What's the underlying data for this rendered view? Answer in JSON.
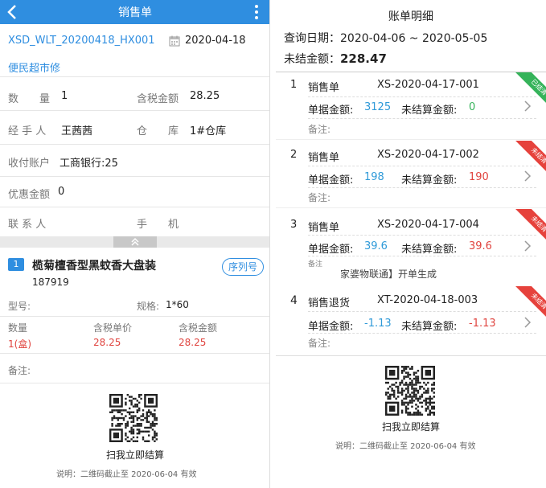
{
  "left": {
    "header": {
      "title": "销售单"
    },
    "bill": {
      "number": "XSD_WLT_20200418_HX001",
      "date": "2020-04-18",
      "customer": "便民超市修"
    },
    "fields": {
      "qty_label": "数　　量",
      "qty_value": "1",
      "tax_amount_label": "含税金额",
      "tax_amount_value": "28.25",
      "handler_label": "经 手 人",
      "handler_value": "王茜茜",
      "warehouse_label": "仓　　库",
      "warehouse_value": "1#仓库",
      "account_label": "收付账户",
      "account_value": "工商银行:25",
      "discount_label": "优惠金额",
      "discount_value": "0",
      "contact_label": "联 系 人",
      "phone_label": "手　　机"
    },
    "item": {
      "index": "1",
      "name": "榄菊檀香型黑蚊香大盘装",
      "code": "187919",
      "serial_button": "序列号",
      "model_label": "型号:",
      "spec_label": "规格:",
      "spec_value": "1*60",
      "qty_label": "数量",
      "price_label": "含税单价",
      "amount_label": "含税金额",
      "qty_value": "1(盒)",
      "price_value": "28.25",
      "amount_value": "28.25",
      "remark_label": "备注:"
    },
    "qr": {
      "caption": "扫我立即结算",
      "note": "说明：二维码截止至 2020-06-04 有效"
    }
  },
  "right": {
    "title": "账单明细",
    "query_range": "查询日期：2020-04-06 ~ 2020-05-05",
    "unsettled_label": "未结金额：",
    "unsettled_value": "228.47",
    "amount_label": "单据金额:",
    "unsettled_item_label": "未结算金额:",
    "remark_label": "备注:",
    "entries": [
      {
        "index": "1",
        "type": "销售单",
        "doc": "XS-2020-04-17-001",
        "amount": "3125",
        "unsettled": "0",
        "status": "已结清"
      },
      {
        "index": "2",
        "type": "销售单",
        "doc": "XS-2020-04-17-002",
        "amount": "198",
        "unsettled": "190",
        "status": "未结清"
      },
      {
        "index": "3",
        "type": "销售单",
        "doc": "XS-2020-04-17-004",
        "amount": "39.6",
        "unsettled": "39.6",
        "status": "未结清"
      },
      {
        "index": "4",
        "type": "销售退货",
        "doc": "XT-2020-04-18-003",
        "amount": "-1.13",
        "unsettled": "-1.13",
        "status": "未结清"
      }
    ],
    "toast": "家婆物联通】开单生成",
    "entry3_remark_partial": "备注",
    "qr": {
      "caption": "扫我立即结算",
      "note": "说明：二维码截止至 2020-06-04 有效"
    }
  },
  "colors": {
    "primary": "#2f8ee0",
    "red": "#e0443f",
    "green": "#35b35a"
  }
}
